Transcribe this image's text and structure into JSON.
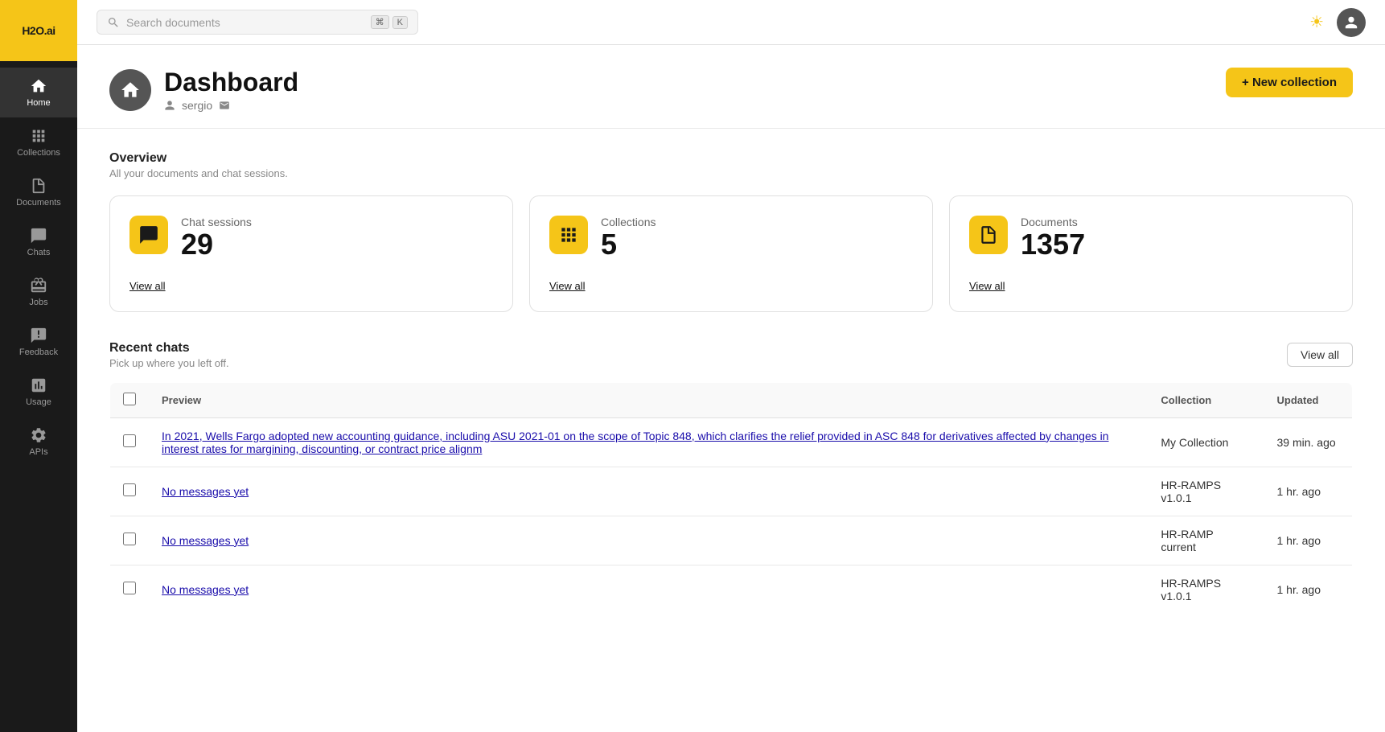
{
  "app": {
    "logo": "H2O.ai"
  },
  "topbar": {
    "search_placeholder": "Search documents",
    "kbd1": "⌘",
    "kbd2": "K"
  },
  "sidebar": {
    "items": [
      {
        "id": "home",
        "label": "Home",
        "active": true
      },
      {
        "id": "collections",
        "label": "Collections",
        "active": false
      },
      {
        "id": "documents",
        "label": "Documents",
        "active": false
      },
      {
        "id": "chats",
        "label": "Chats",
        "active": false
      },
      {
        "id": "jobs",
        "label": "Jobs",
        "active": false
      },
      {
        "id": "feedback",
        "label": "Feedback",
        "active": false
      },
      {
        "id": "usage",
        "label": "Usage",
        "active": false
      },
      {
        "id": "apis",
        "label": "APIs",
        "active": false
      }
    ]
  },
  "page": {
    "title": "Dashboard",
    "user": "sergio",
    "new_collection_label": "+ New collection"
  },
  "overview": {
    "title": "Overview",
    "subtitle": "All your documents and chat sessions.",
    "cards": [
      {
        "label": "Chat sessions",
        "count": "29",
        "view_all": "View all"
      },
      {
        "label": "Collections",
        "count": "5",
        "view_all": "View all"
      },
      {
        "label": "Documents",
        "count": "1357",
        "view_all": "View all"
      }
    ]
  },
  "recent_chats": {
    "title": "Recent chats",
    "subtitle": "Pick up where you left off.",
    "view_all": "View all",
    "columns": [
      "Preview",
      "Collection",
      "Updated"
    ],
    "rows": [
      {
        "preview": "In 2021, Wells Fargo adopted new accounting guidance, including ASU 2021-01 on the scope of Topic 848, which clarifies the relief provided in ASC 848 for derivatives affected by changes in interest rates for margining, discounting, or contract price alignm",
        "collection": "My Collection",
        "updated": "39 min. ago"
      },
      {
        "preview": "No messages yet",
        "collection": "HR-RAMPS v1.0.1",
        "updated": "1 hr. ago"
      },
      {
        "preview": "No messages yet",
        "collection": "HR-RAMP current",
        "updated": "1 hr. ago"
      },
      {
        "preview": "No messages yet",
        "collection": "HR-RAMPS v1.0.1",
        "updated": "1 hr. ago"
      }
    ]
  }
}
